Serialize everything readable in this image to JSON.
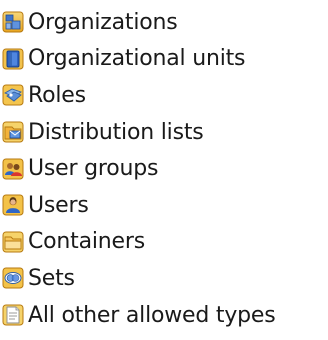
{
  "type_list": {
    "items": [
      {
        "label": "Organizations",
        "icon": "organizations-icon"
      },
      {
        "label": "Organizational units",
        "icon": "organizational-units-icon"
      },
      {
        "label": "Roles",
        "icon": "roles-icon"
      },
      {
        "label": "Distribution lists",
        "icon": "distribution-lists-icon"
      },
      {
        "label": "User groups",
        "icon": "user-groups-icon"
      },
      {
        "label": "Users",
        "icon": "users-icon"
      },
      {
        "label": "Containers",
        "icon": "containers-icon"
      },
      {
        "label": "Sets",
        "icon": "sets-icon"
      },
      {
        "label": "All other allowed types",
        "icon": "all-other-types-icon"
      }
    ]
  }
}
